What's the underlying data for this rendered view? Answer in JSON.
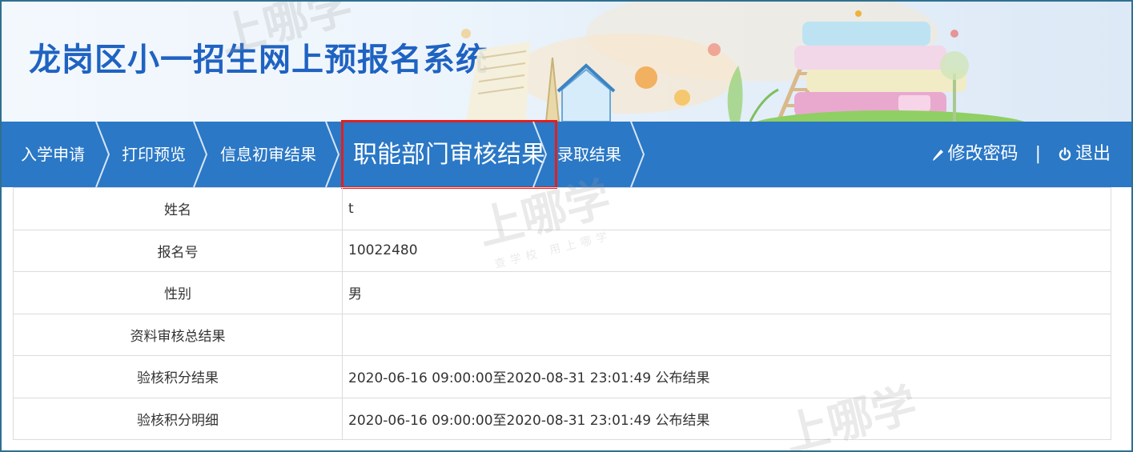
{
  "header": {
    "title": "龙岗区小一招生网上预报名系统"
  },
  "nav": {
    "items": [
      {
        "label": "入学申请"
      },
      {
        "label": "打印预览"
      },
      {
        "label": "信息初审结果"
      },
      {
        "label": "职能部门审核结果"
      },
      {
        "label": "录取结果"
      }
    ],
    "active_index": 3,
    "change_password": "修改密码",
    "separator": "|",
    "logout": "退出"
  },
  "info": {
    "rows": [
      {
        "label": "姓名",
        "value": "t"
      },
      {
        "label": "报名号",
        "value": "10022480"
      },
      {
        "label": "性别",
        "value": "男"
      },
      {
        "label": "资料审核总结果",
        "value": ""
      },
      {
        "label": "验核积分结果",
        "value": "2020-06-16 09:00:00至2020-08-31 23:01:49 公布结果"
      },
      {
        "label": "验核积分明细",
        "value": "2020-06-16 09:00:00至2020-08-31 23:01:49 公布结果"
      }
    ]
  },
  "watermark": {
    "text": "上哪学",
    "subtext": "查学校 用上哪学"
  },
  "colors": {
    "nav_bg": "#2b78c6",
    "title": "#1f63c2",
    "active_border": "#e02020",
    "border": "#dcdcdc"
  },
  "icons": {
    "change_password": "pencil-icon",
    "logout": "power-icon"
  }
}
